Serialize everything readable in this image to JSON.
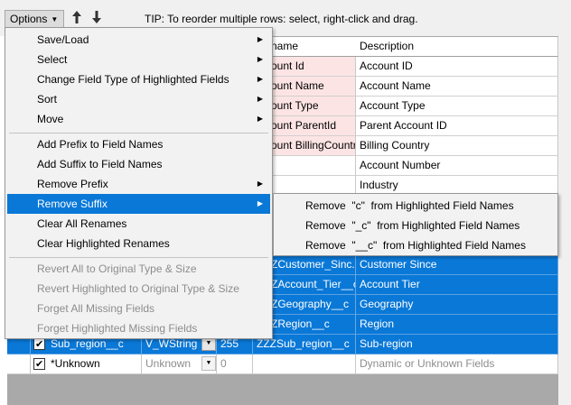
{
  "toolbar": {
    "options_label": "Options",
    "tip": "TIP: To reorder multiple rows: select, right-click and drag.",
    "move_up_icon": "arrow-up-icon",
    "move_down_icon": "arrow-down-icon"
  },
  "grid": {
    "headers": {
      "name": "name",
      "description": "Description"
    },
    "rows": [
      {
        "name": "ount Id",
        "desc": "Account ID"
      },
      {
        "name": "ount Name",
        "desc": "Account Name"
      },
      {
        "name": "ount Type",
        "desc": "Account Type"
      },
      {
        "name": "ount ParentId",
        "desc": "Parent Account ID"
      },
      {
        "name": "ount BillingCountry",
        "desc": "Billing Country"
      },
      {
        "name": "",
        "desc": "Account Number"
      },
      {
        "name": "",
        "desc": "Industry"
      }
    ],
    "selected_rows": [
      {
        "name": "ZCustomer_Sinc...",
        "desc": "Customer Since"
      },
      {
        "name": "ZAccount_Tier__c",
        "desc": "Account Tier"
      },
      {
        "name": "ZGeography__c",
        "desc": "Geography"
      },
      {
        "name": "ZRegion__c",
        "desc": "Region"
      }
    ],
    "sub_region_row": {
      "field": "Sub_region__c",
      "type": "V_WString",
      "size": "255",
      "name": "ZZZSub_region__c",
      "desc": "Sub-region"
    },
    "unknown_row": {
      "field": "*Unknown",
      "type": "Unknown",
      "size": "0",
      "name": "",
      "desc": "Dynamic or Unknown Fields"
    }
  },
  "menu": {
    "items": [
      {
        "label": "Save/Load",
        "submenu": true
      },
      {
        "label": "Select",
        "submenu": true
      },
      {
        "label": "Change Field Type of Highlighted Fields",
        "submenu": true
      },
      {
        "label": "Sort",
        "submenu": true
      },
      {
        "label": "Move",
        "submenu": true
      },
      {
        "label": "Add Prefix to Field Names"
      },
      {
        "label": "Add Suffix to Field Names"
      },
      {
        "label": "Remove Prefix",
        "submenu": true
      },
      {
        "label": "Remove Suffix",
        "submenu": true,
        "highlighted": true
      },
      {
        "label": "Clear All Renames"
      },
      {
        "label": "Clear Highlighted Renames"
      },
      {
        "label": "Revert All to Original Type & Size",
        "disabled": true
      },
      {
        "label": "Revert Highlighted to Original Type & Size",
        "disabled": true
      },
      {
        "label": "Forget All Missing Fields",
        "disabled": true
      },
      {
        "label": "Forget Highlighted Missing Fields",
        "disabled": true
      }
    ]
  },
  "submenu": {
    "items": [
      "Remove  \"c\"  from Highlighted Field Names",
      "Remove  \"_c\"  from Highlighted Field Names",
      "Remove  \"__c\"  from Highlighted Field Names"
    ]
  },
  "colors": {
    "accent": "#0a78d7",
    "menu_bg": "#f2f2f2",
    "renamed_bg": "#fde4e4"
  }
}
